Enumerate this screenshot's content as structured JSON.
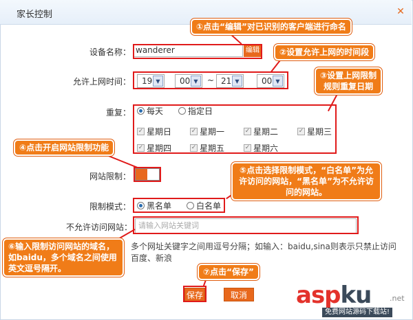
{
  "window": {
    "title": "家长控制",
    "close_glyph": "✕"
  },
  "device_name": {
    "label": "设备名称：",
    "value": "wanderer",
    "edit_label": "编辑"
  },
  "time": {
    "label": "允许上网时间：",
    "start_hour": "19",
    "start_min": "00",
    "separator": "~",
    "end_hour": "21",
    "end_min": "00"
  },
  "repeat": {
    "label": "重复：",
    "modes": [
      "每天",
      "指定日"
    ],
    "days": [
      "星期日",
      "星期一",
      "星期二",
      "星期三",
      "星期四",
      "星期五",
      "星期六"
    ]
  },
  "site_limit": {
    "label": "网站限制："
  },
  "limit_mode": {
    "label": "限制模式：",
    "options": [
      "黑名单",
      "白名单"
    ]
  },
  "blocked_sites": {
    "label": "不允许访问网站：",
    "placeholder": "请输入网站关键词",
    "hint_line1": "多个网址关键字之间用逗号分隔；如输入：baidu,sina则表示只禁止访问",
    "hint_line2": "百度、新浪"
  },
  "buttons": {
    "save": "保存",
    "cancel": "取消"
  },
  "callouts": {
    "c1": "①点击“编辑”对已识别的客户端进行命名",
    "c2": "②设置允许上网的时间段",
    "c3_line1": "③设置上网限制",
    "c3_line2": "规则重复日期",
    "c4": "④点击开启网站限制功能",
    "c5": "⑤点击选择限制模式，“白名单”为允许访问的网站，“黑名单”为不允许访问的网站。",
    "c6": "⑥输入限制访问网站的域名，如baidu，多个域名之间使用英文逗号隔开。",
    "c7": "⑦点击“保存”"
  },
  "watermark": {
    "asp": "asp",
    "ku": "ku",
    "net": ".net",
    "sub": "免费网站源码下载站!"
  },
  "colors": {
    "accent": "#e8681c",
    "callout": "#f07c18",
    "highlight": "#e01a1a"
  }
}
